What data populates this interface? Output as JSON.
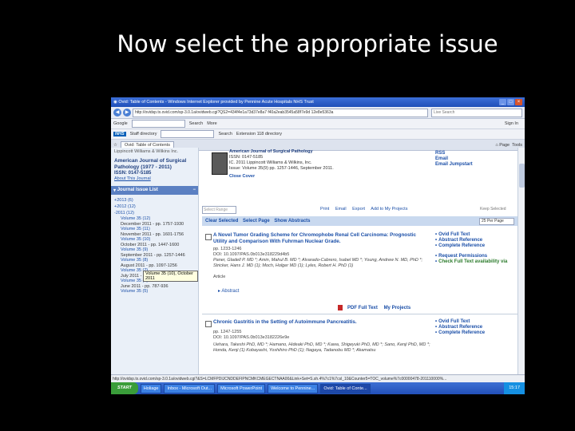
{
  "slide": {
    "title": "Now select the appropriate issue"
  },
  "browser": {
    "window_title": "Ovid: Table of Contents - Windows Internet Explorer provided by Pennine Acute Hospitals NHS Trust",
    "address": "http://ovidsp.tx.ovid.com/sp-3.0.1a/ovidweb.cgi?QS2=434f4e1a73d37e8a7 f40a2eab3545a58f7e9d 12e8e5363a",
    "search_placeholder": "Live Search",
    "google_label": "Google",
    "google_items": [
      "Search",
      "More",
      "Sign In"
    ],
    "nhs_logo": "NHS",
    "nhs_items": [
      "Staff directory",
      "Search",
      "Extension 118 directory"
    ],
    "tab_label": "Ovid: Table of Contents",
    "tab_tools": [
      "Page",
      "Tools"
    ],
    "status_url": "http://ovidsp.tx.ovid.com/sp-3.0.1a/ovidweb.cgi?&S=LCMFPDIJCNDDEFIPNCMKCMEGECTNAA00&Link+Set=S.sh.4%7c1%7csl_10&Counter5=TOC_volume%7c00000478-201110000%..."
  },
  "leftcol": {
    "publisher": "Lippincott Williams & Wilkins Inc.",
    "journal_name": "American Journal of Surgical Pathology (1977 - 2011)",
    "issn": "ISSN: 0147-5185",
    "about": "About This Journal",
    "issue_list_header": "Journal Issue List",
    "years": [
      "+2013 (6)",
      "+2012 (12)",
      "-2011 (12)"
    ],
    "issues": [
      {
        "vol": "Volume 35 (12)",
        "month": "December 2011 - pp. 1757-1930"
      },
      {
        "vol": "Volume 35 (11)",
        "month": "November 2011 - pp. 1601-1756"
      },
      {
        "vol": "Volume 35 (10)",
        "month": "October 2011 - pp. 1447-1600"
      },
      {
        "vol": "Volume 35 (9)",
        "month": "September 2011 - pp. 1257-1446"
      },
      {
        "vol": "Volume 35 (8)",
        "month": "August 2011 - pp. 1097-1256"
      },
      {
        "vol": "Volume 35 (7)",
        "month": "July 2011 - pp. 937-1096"
      },
      {
        "vol": "Volume 35 (6)",
        "month": "June 2011 - pp. 787-936"
      },
      {
        "vol": "Volume 35 (5)",
        "month": ""
      }
    ],
    "tooltip": "Volume 35 (10), October 2011"
  },
  "main": {
    "journal_info": [
      "American Journal of Surgical Pathology",
      "ISSN: 0147-5185",
      "IC. 2011 Lippincott Williams & Wilkins, Inc.",
      "Issue: Volume 35(9) pp. 1257-1446, September 2011."
    ],
    "close_cover": "Close Cover",
    "right_links": [
      "RSS",
      "Email",
      "Email Jumpstart"
    ],
    "select_range": "Select Range",
    "tools": [
      "Print",
      "Email",
      "Export",
      "Add to My Projects"
    ],
    "keep_selected": "Keep Selected",
    "bar_links": [
      "Clear Selected",
      "Select Page",
      "Show Abstracts"
    ],
    "per_page": "25 Per Page",
    "article1": {
      "title": "A Novel Tumor Grading Scheme for Chromophobe Renal Cell Carcinoma: Prognostic Utility and Comparison With Fuhrman Nuclear Grade.",
      "pages": "pp. 1233-1246",
      "doi": "DOI: 10.1097/PAS.0b013e318229d4b5",
      "authors": "Paner, Gladell P. MD *; Amin, Mahul B. MD *; Alvarado-Cabrero, Isabel MD *; Young, Andrew N. MD, PhD *; Stricker, Hans J. MD (1); Moch, Holger MD (1); Lyles, Robert H. PhD (1)",
      "type": "Article",
      "abstract": "Abstract",
      "side": [
        "Ovid Full Text",
        "Abstract Reference",
        "Complete Reference",
        "Request Permissions",
        "Check Full Text availability via"
      ],
      "pdf": "PDF Full Text",
      "my_projects": "My Projects"
    },
    "article2": {
      "title": "Chronic Gastritis in the Setting of Autoimmune Pancreatitis.",
      "pages": "pp. 1247-1255",
      "doi": "DOI: 10.1097/PAS.0b013e3182226e9e",
      "authors": "Uehara, Takeshi PhD, MD *; Hamano, Hideaki PhD, MD *; Kawa, Shigeyuki PhD, MD *; Sano, Kenji PhD, MD *; Honda, Kenji (1) Kobayashi, Yoshihiro PhD (1); Nagaya, Tadanobu MD *; Akamatsu",
      "side": [
        "Ovid Full Text",
        "Abstract Reference",
        "Complete Reference"
      ]
    }
  },
  "taskbar": {
    "start": "START",
    "tasks": [
      "Holiage",
      "Inbox - Microsoft Out...",
      "Microsoft PowerPoint",
      "Welcome to Pennine...",
      "Ovid: Table of Conte..."
    ],
    "tray_internet": "Internet",
    "clock": "15:17"
  }
}
